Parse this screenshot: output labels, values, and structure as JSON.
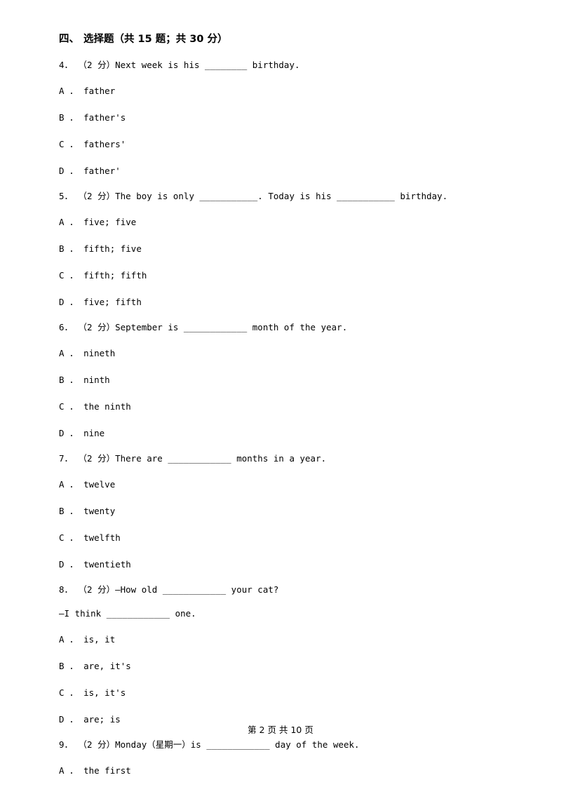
{
  "section": {
    "number": "四、",
    "title": "选择题（共 15 题；共 30 分）"
  },
  "questions": [
    {
      "stem": "4． （2 分）Next week is his ________ birthday.",
      "options": [
        "A ． father",
        "B ． father's",
        "C ． fathers'",
        "D ． father'"
      ]
    },
    {
      "stem": "5． （2 分）The boy is only ___________. Today is his ___________ birthday.",
      "options": [
        "A ． five; five",
        "B ． fifth; five",
        "C ． fifth; fifth",
        "D ． five; fifth"
      ]
    },
    {
      "stem": "6． （2 分）September is ____________ month of the year.",
      "options": [
        "A ． nineth",
        "B ． ninth",
        "C ． the ninth",
        "D ． nine"
      ]
    },
    {
      "stem": "7． （2 分）There are ____________ months in a year.",
      "options": [
        "A ． twelve",
        "B ． twenty",
        "C ． twelfth",
        "D ． twentieth"
      ]
    },
    {
      "stem": "8． （2 分）—How old ____________ your cat?",
      "continuation": "—I think ____________ one.",
      "options": [
        "A ． is, it",
        "B ． are, it's",
        "C ． is, it's",
        "D ． are; is"
      ]
    },
    {
      "stem": "9． （2 分）Monday（星期一）is ____________ day of the week.",
      "options": [
        "A ． the first"
      ]
    }
  ],
  "footer": {
    "text": "第 2 页 共 10 页"
  }
}
